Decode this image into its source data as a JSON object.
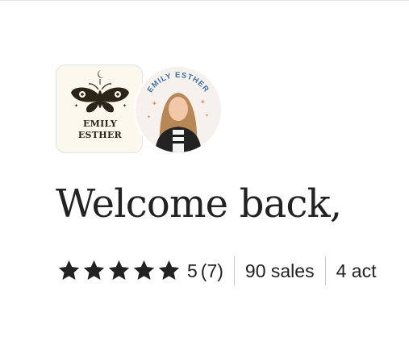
{
  "shop": {
    "logo_line1": "EMILY",
    "logo_line2": "ESTHER",
    "avatar_text": "EMILY ESTHER"
  },
  "welcome": {
    "heading": "Welcome back,"
  },
  "stats": {
    "rating": 5,
    "stars_filled": 5,
    "rating_value": "5",
    "review_count": "(7)",
    "sales": "90 sales",
    "active": "4 act"
  },
  "colors": {
    "logo_background": "#fbf8ee",
    "avatar_text": "#3f6fa8",
    "sparkle": "#d98b6b",
    "star": "#222222"
  }
}
